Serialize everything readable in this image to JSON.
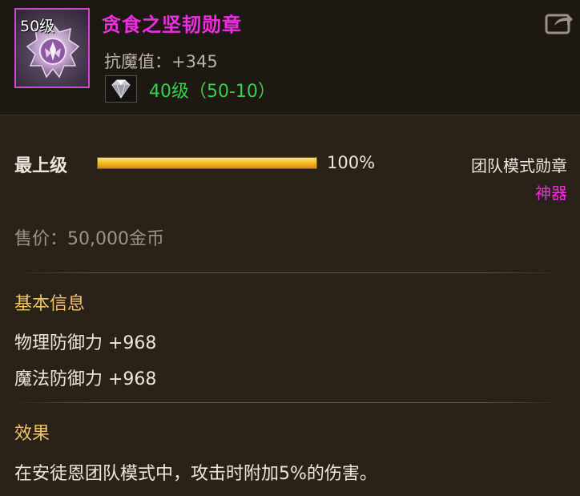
{
  "item": {
    "level_badge": "50级",
    "name": "贪食之坚韧勋章",
    "resist": "抗魔值：+345",
    "gem_level": "40级（50-10）"
  },
  "grade": {
    "label": "最上级",
    "progress": 1.0,
    "percent_text": "100%"
  },
  "category": "团队模式勋章",
  "rarity": "神器",
  "price": "售价：50,000金币",
  "basic": {
    "title": "基本信息",
    "stats": [
      "物理防御力 +968",
      "魔法防御力 +968"
    ]
  },
  "effect": {
    "title": "效果",
    "text": "在安徒恩团队模式中，攻击时附加5%的伤害。"
  },
  "colors": {
    "name": "#ee2ee0",
    "gem_level": "#32d34a",
    "section_title": "#f1c36a",
    "bar": "#f4b41c"
  },
  "icons": [
    "medal-icon",
    "gem-icon",
    "share-icon"
  ]
}
